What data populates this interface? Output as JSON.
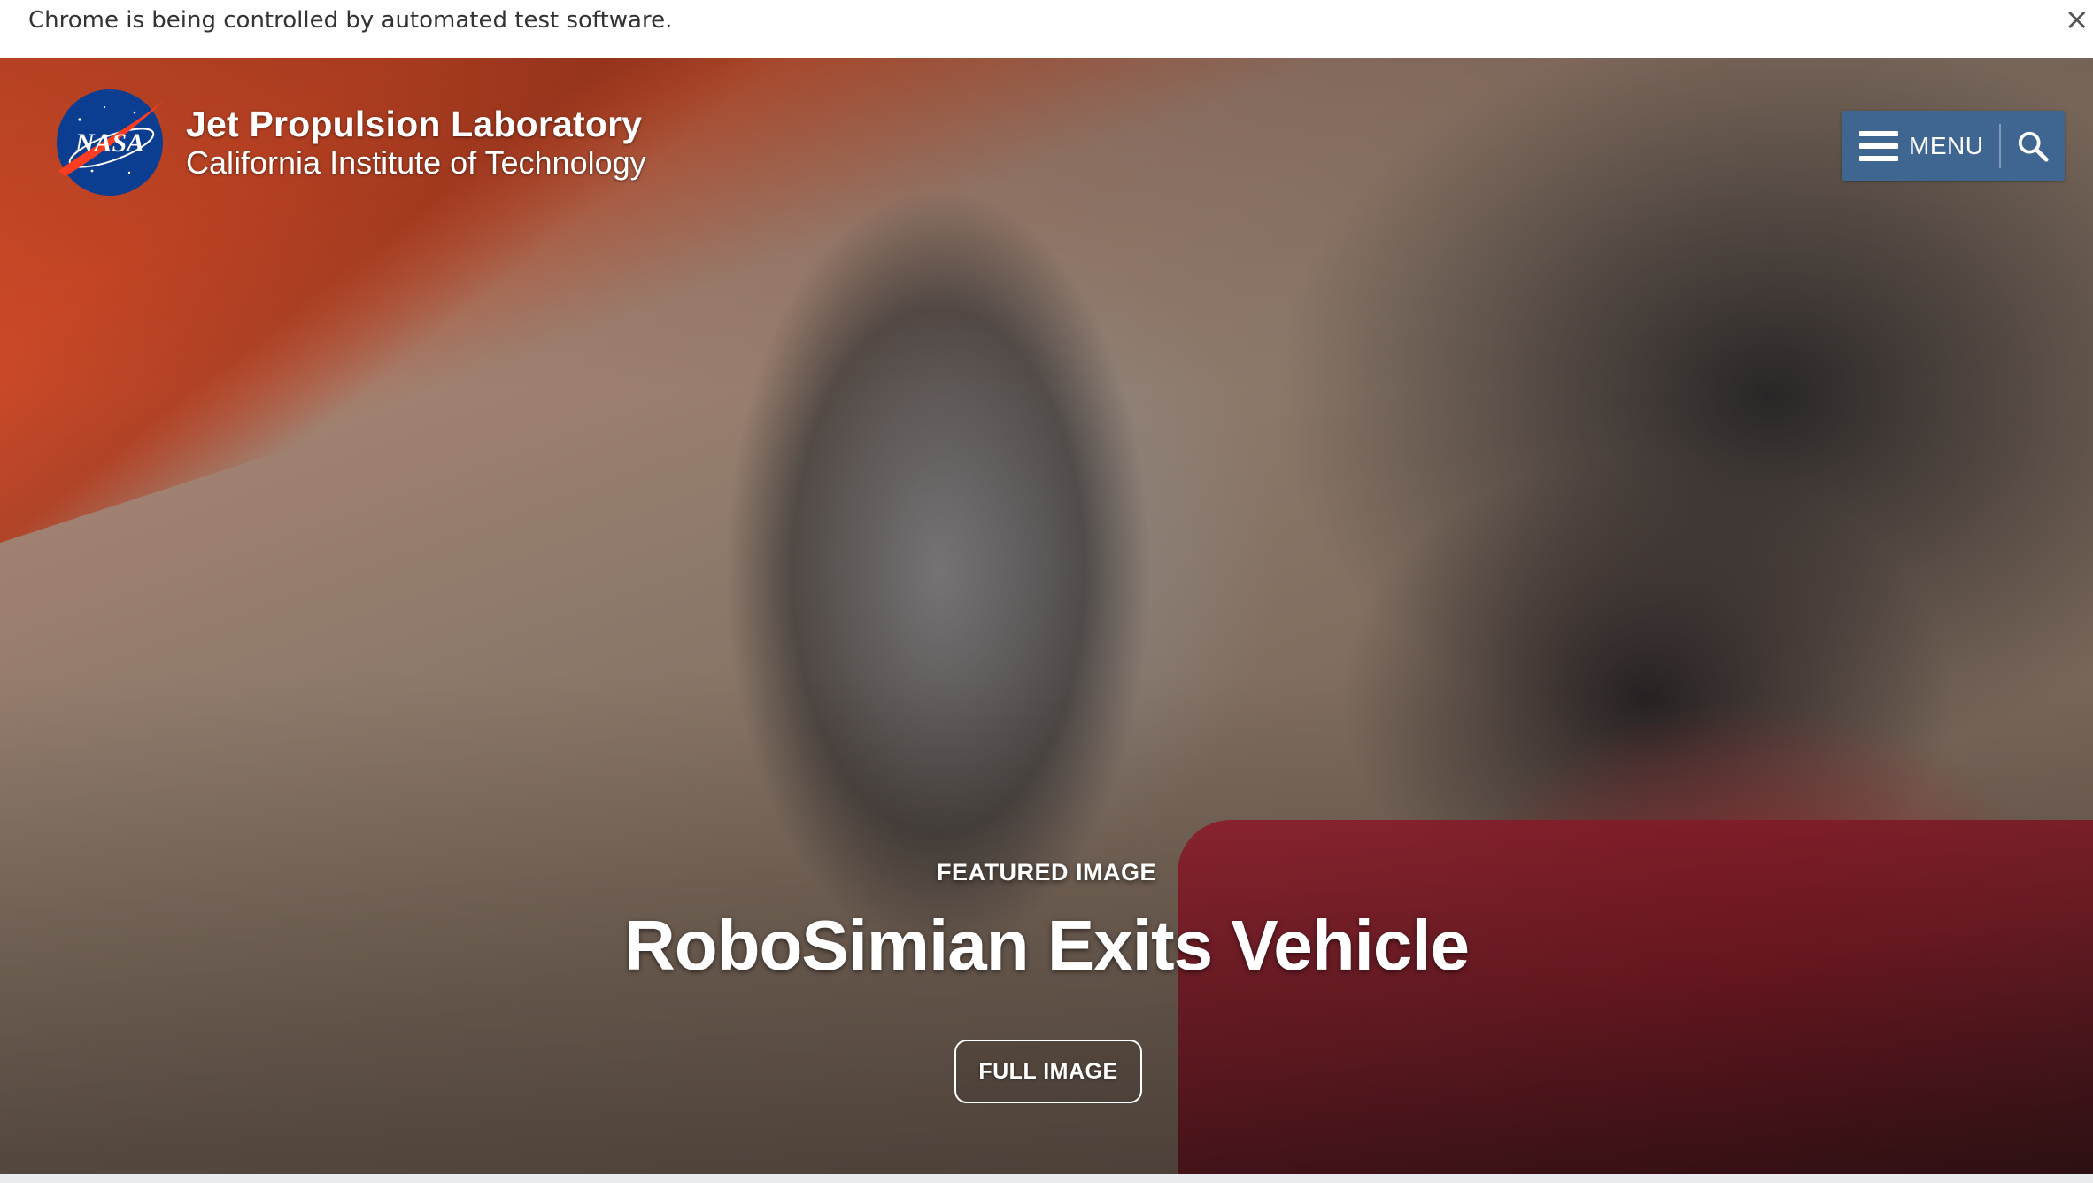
{
  "browser": {
    "automation_notice": "Chrome is being controlled by automated test software.",
    "close_glyph": "×"
  },
  "header": {
    "logo_icon": "nasa-meatball-icon",
    "logo_text": "NASA",
    "title": "Jet Propulsion Laboratory",
    "subtitle": "California Institute of Technology",
    "menu_label": "MENU",
    "menu_icon": "hamburger-icon",
    "search_icon": "search-icon",
    "nav_color": "#3f6591"
  },
  "hero": {
    "kicker": "FEATURED IMAGE",
    "title": "RoboSimian Exits Vehicle",
    "button_label": "FULL IMAGE"
  }
}
